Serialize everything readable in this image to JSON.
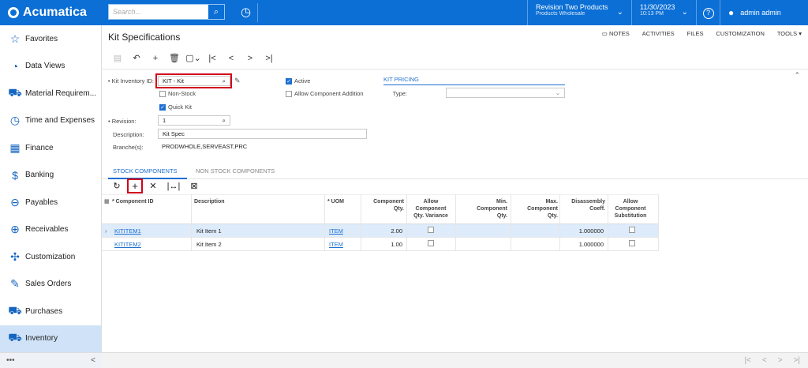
{
  "app": {
    "name": "Acumatica"
  },
  "topbar": {
    "search_placeholder": "Search...",
    "company_line1": "Revision Two Products",
    "company_line2": "Products Wholesale",
    "date": "11/30/2023",
    "time": "10:13 PM",
    "user": "admin admin"
  },
  "sidebar": {
    "items": [
      {
        "label": "Favorites",
        "icon": "star-icon"
      },
      {
        "label": "Data Views",
        "icon": "pie-chart-icon"
      },
      {
        "label": "Material Requirem...",
        "icon": "cart-icon"
      },
      {
        "label": "Time and Expenses",
        "icon": "clock-icon"
      },
      {
        "label": "Finance",
        "icon": "calculator-icon"
      },
      {
        "label": "Banking",
        "icon": "dollar-icon"
      },
      {
        "label": "Payables",
        "icon": "minus-circle-icon"
      },
      {
        "label": "Receivables",
        "icon": "plus-circle-icon"
      },
      {
        "label": "Customization",
        "icon": "puzzle-icon"
      },
      {
        "label": "Sales Orders",
        "icon": "pencil-square-icon"
      },
      {
        "label": "Purchases",
        "icon": "cart-icon"
      },
      {
        "label": "Inventory",
        "icon": "truck-icon"
      }
    ],
    "bottom_left": "•••",
    "bottom_right": "<"
  },
  "page": {
    "title": "Kit Specifications",
    "links": [
      "NOTES",
      "ACTIVITIES",
      "FILES",
      "CUSTOMIZATION",
      "TOOLS ▾"
    ]
  },
  "form": {
    "kit_inventory_label": "• Kit Inventory ID:",
    "kit_inventory_value": "KIT - Kit",
    "non_stock_label": "Non-Stock",
    "quick_kit_label": "Quick Kit",
    "revision_label": "• Revision:",
    "revision_value": "1",
    "description_label": "Description:",
    "description_value": "Kit Spec",
    "branches_label": "Branche(s):",
    "branches_value": "PRODWHOLE,SERVEAST,PRC",
    "active_label": "Active",
    "allow_component_addition_label": "Allow Component Addition",
    "kit_pricing_label": "KIT PRICING",
    "type_label": "Type:",
    "type_value": ""
  },
  "tabs": {
    "stock": "STOCK COMPONENTS",
    "nonstock": "NON STOCK COMPONENTS"
  },
  "grid": {
    "headers": {
      "component_id": "* Component ID",
      "description": "Description",
      "uom": "* UOM",
      "qty_1": "Component",
      "qty_2": "Qty.",
      "var_1": "Allow",
      "var_2": "Component",
      "var_3": "Qty. Variance",
      "min_1": "Min.",
      "min_2": "Component",
      "min_3": "Qty.",
      "max_1": "Max.",
      "max_2": "Component",
      "max_3": "Qty.",
      "dis_1": "Disassembly",
      "dis_2": "Coeff.",
      "sub_1": "Allow",
      "sub_2": "Component",
      "sub_3": "Substitution"
    },
    "rows": [
      {
        "component_id": "KITITEM1",
        "description": "Kit Item 1",
        "uom": "ITEM",
        "qty": "2.00",
        "coeff": "1.000000"
      },
      {
        "component_id": "KITITEM2",
        "description": "Kit Item 2",
        "uom": "ITEM",
        "qty": "1.00",
        "coeff": "1.000000"
      }
    ]
  },
  "colors": {
    "accent": "#0b6fd6",
    "highlight": "#d0021b"
  }
}
